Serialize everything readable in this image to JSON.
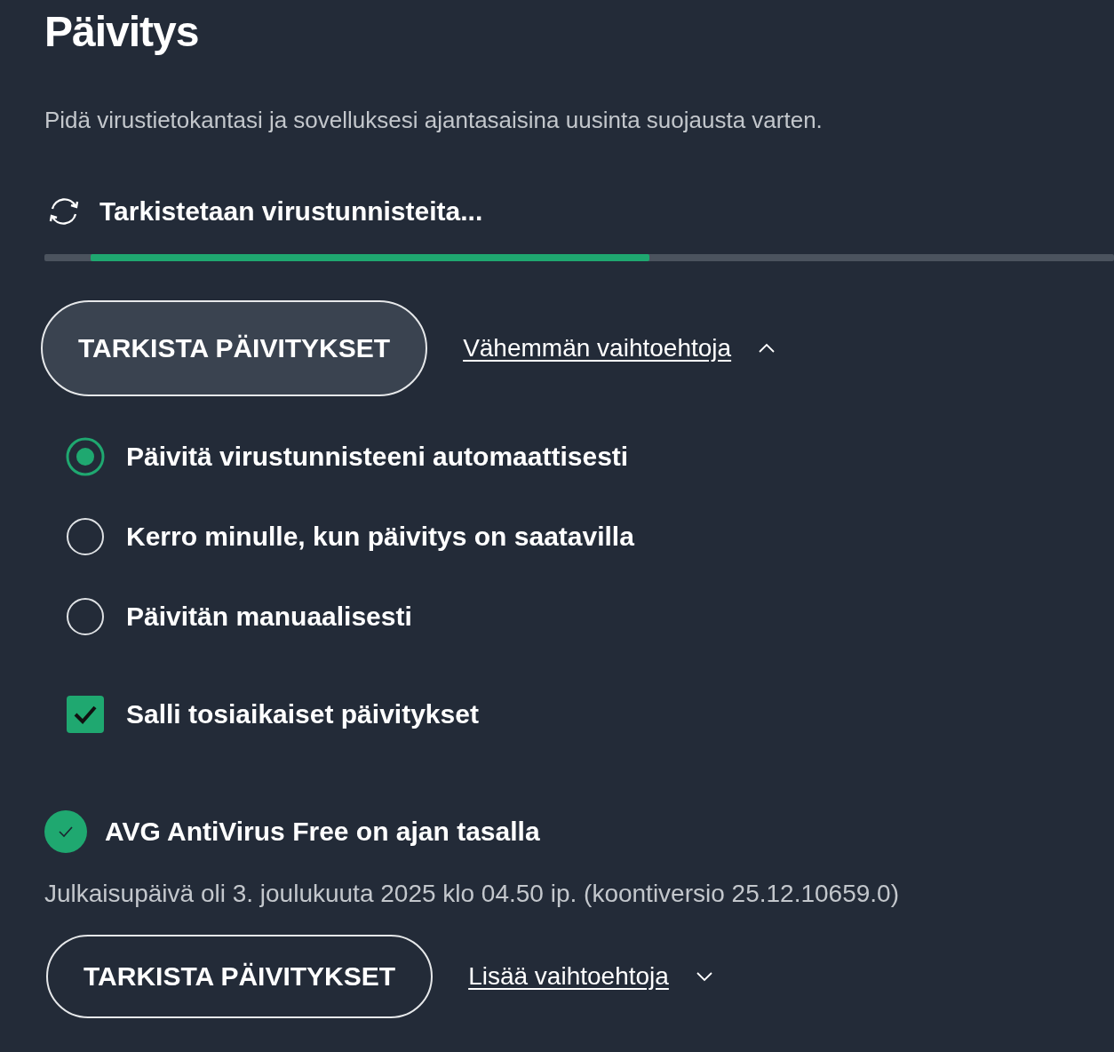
{
  "title": "Päivitys",
  "description": "Pidä virustietokantasi ja sovelluksesi ajantasaisina uusinta suojausta varten.",
  "progress": {
    "label": "Tarkistetaan virustunnisteita..."
  },
  "actions": [
    {
      "kind": "button",
      "label": "TARKISTA PÄIVITYKSET",
      "hovered": true
    },
    {
      "kind": "toggle",
      "label": "Vähemmän vaihtoehtoja",
      "expanded": true
    }
  ],
  "options": [
    {
      "kind": "radio",
      "label": "Päivitä virustunnisteeni automaattisesti",
      "selected": true
    },
    {
      "kind": "radio",
      "label": "Kerro minulle, kun päivitys on saatavilla",
      "selected": false
    },
    {
      "kind": "radio",
      "label": "Päivitän manuaalisesti",
      "selected": false
    },
    {
      "kind": "checkbox",
      "label": "Salli tosiaikaiset päivitykset",
      "checked": true
    }
  ],
  "app_status": {
    "label": "AVG AntiVirus Free on ajan tasalla",
    "ok": true,
    "detail": "Julkaisupäivä oli 3. joulukuuta 2025 klo 04.50 ip. (koontiversio 25.12.10659.0)"
  },
  "app_actions": [
    {
      "kind": "button",
      "label": "TARKISTA PÄIVITYKSET",
      "hovered": false
    },
    {
      "kind": "toggle",
      "label": "Lisää vaihtoehtoja",
      "expanded": false
    }
  ]
}
